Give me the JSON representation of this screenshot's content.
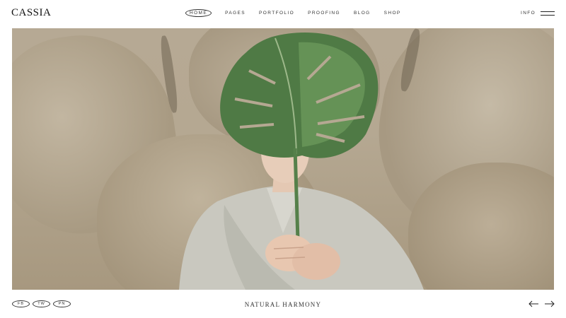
{
  "brand": {
    "logo": "CASSIA"
  },
  "nav": {
    "items": [
      {
        "label": "HOME",
        "active": true
      },
      {
        "label": "PAGES",
        "active": false
      },
      {
        "label": "PORTFOLIO",
        "active": false
      },
      {
        "label": "PROOFING",
        "active": false
      },
      {
        "label": "BLOG",
        "active": false
      },
      {
        "label": "SHOP",
        "active": false
      }
    ],
    "info_label": "INFO",
    "menu_icon": "hamburger-icon"
  },
  "hero": {
    "image": "person-holding-monstera-leaf-in-front-of-face-rocky-background"
  },
  "footer": {
    "social": [
      "FB",
      "TW",
      "PN"
    ],
    "caption": "NATURAL HARMONY",
    "prev_icon": "arrow-left-icon",
    "next_icon": "arrow-right-icon"
  },
  "colors": {
    "text": "#222222",
    "background": "#ffffff",
    "leaf": "#4f7a45"
  }
}
